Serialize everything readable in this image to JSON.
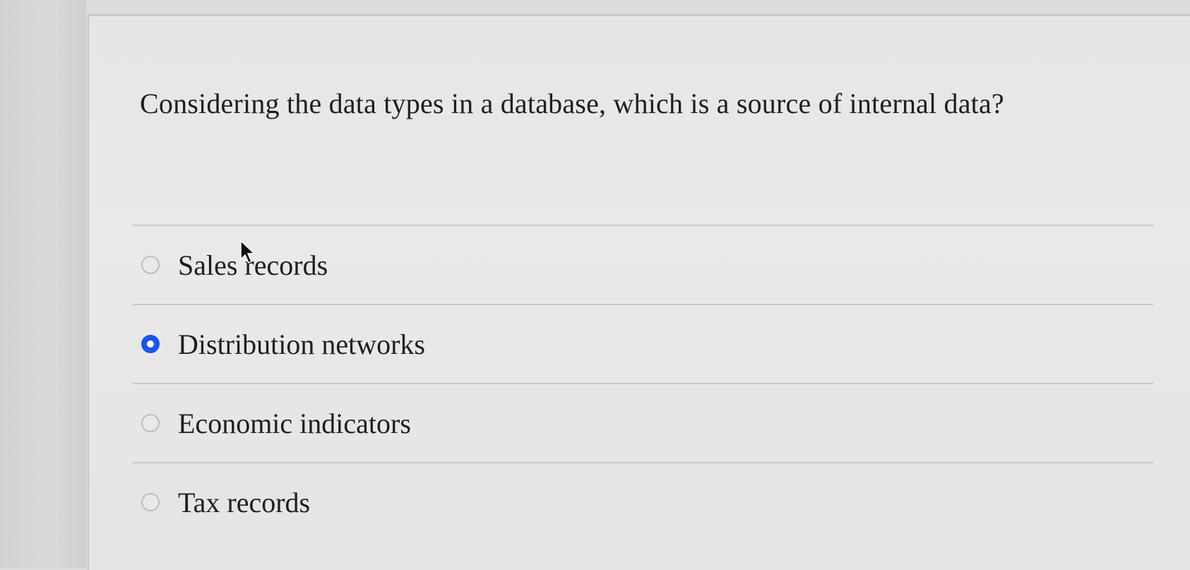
{
  "question": {
    "text": "Considering the data types in a database, which is a source of internal data?"
  },
  "options": [
    {
      "label": "Sales records",
      "selected": false
    },
    {
      "label": "Distribution networks",
      "selected": true
    },
    {
      "label": "Economic indicators",
      "selected": false
    },
    {
      "label": "Tax records",
      "selected": false
    }
  ],
  "colors": {
    "selected_radio": "#1a56e8",
    "text": "#1e1e1e",
    "background": "#e6e6e6"
  },
  "icons": {
    "cursor": "arrow-cursor-icon"
  }
}
